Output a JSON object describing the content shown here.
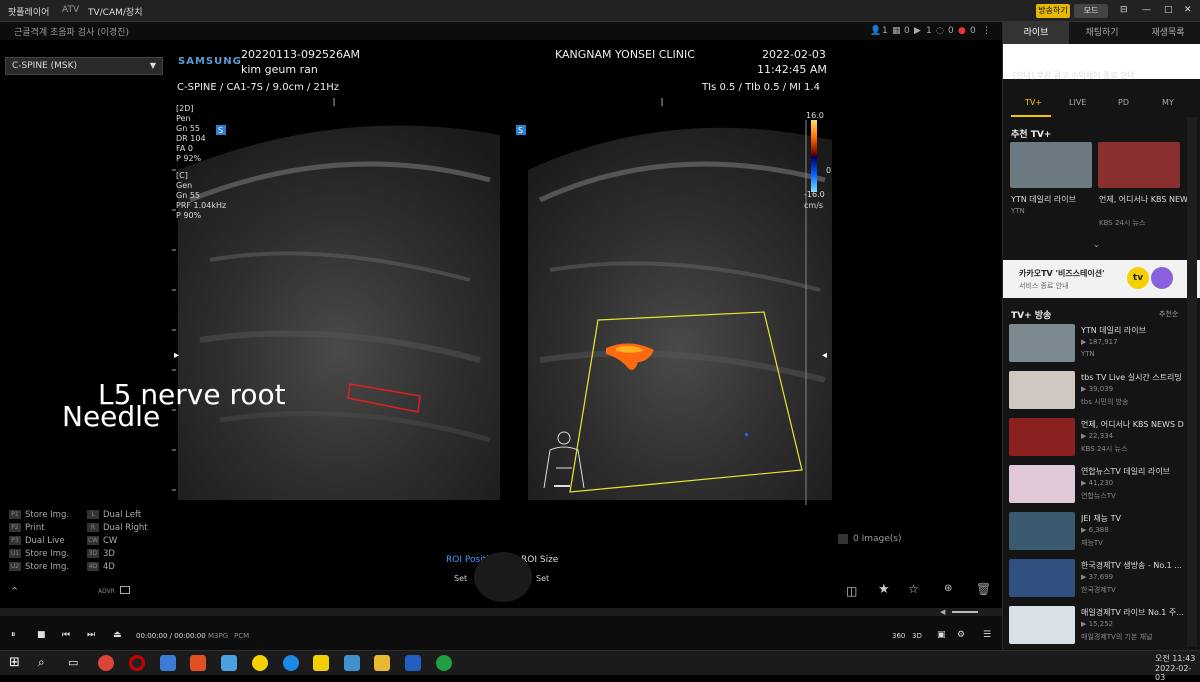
{
  "titlebar": {
    "app": "팟플레이어",
    "atv": "ATV",
    "menu": "TV/CAM/장치",
    "broadcast_btn": "방송하기",
    "mode_btn": "모드"
  },
  "toolbar2": {
    "caption": "근골격계 초음파 검사 (이경진)",
    "stats": [
      "1",
      "0",
      "1",
      "0",
      "0",
      "0"
    ]
  },
  "preset": {
    "value": "C-SPINE (MSK)"
  },
  "ultrasound": {
    "brand": "SAMSUNG",
    "study_id": "20220113-092526AM",
    "patient": "kim geum ran",
    "clinic": "KANGNAM YONSEI CLINIC",
    "date": "2022-02-03",
    "time": "11:42:45 AM",
    "probe": "C-SPINE / CA1-7S / 9.0cm / 21Hz",
    "tis": "TIs  0.5 / TIb  0.5 / MI   1.4",
    "scale_top": "16.0",
    "scale_zero": "0",
    "scale_bottom": "-16.0",
    "scale_unit": "cm/s",
    "params_2d": [
      "[2D]",
      "Pen",
      "Gn    55",
      "DR    104",
      "FA    0",
      "P      92%"
    ],
    "params_c": [
      "[C]",
      "Gen",
      "Gn    55",
      "PRF  1.04kHz",
      "P      90%"
    ],
    "s_marker": "S"
  },
  "overlay": {
    "l5": "L5 nerve root",
    "needle": "Needle"
  },
  "shortcuts": [
    {
      "k": "P1",
      "t": "Store Img."
    },
    {
      "k": "P2",
      "t": "Print"
    },
    {
      "k": "P3",
      "t": "Dual Live"
    },
    {
      "k": "U1",
      "t": "Store Img."
    },
    {
      "k": "U2",
      "t": "Store Img."
    },
    {
      "k": "L",
      "t": "Dual Left"
    },
    {
      "k": "R",
      "t": "Dual Right"
    },
    {
      "k": "CW",
      "t": "CW"
    },
    {
      "k": "3D",
      "t": "3D"
    },
    {
      "k": "4D",
      "t": "4D"
    }
  ],
  "roi": {
    "position": "ROI Position",
    "size": "ROI Size",
    "set_left": "Set",
    "set_right": "Set"
  },
  "images_count": "0 Image(s)",
  "player": {
    "time": "00:00:00 / 00:00:00",
    "codec1": "M3PG",
    "codec2": "PCM",
    "deg": "360",
    "d3": "3D",
    "adv": "ADVR"
  },
  "taskbar": {
    "clock": "오전 11:43",
    "date": "2022-02-03"
  },
  "side": {
    "tabs": [
      "라이브",
      "채팅하기",
      "재생목록"
    ],
    "notice": "[안내] 후원 광고 수익쉐어 종료 안내",
    "subtabs": [
      "TV+",
      "LIVE",
      "PD",
      "MY"
    ],
    "rec_title": "추천 TV+",
    "rec": [
      {
        "t": "YTN 데일리 라이브",
        "s": "YTN"
      },
      {
        "t": "언제, 어디서나 KBS NEWS D",
        "s": "KBS 24시 뉴스"
      }
    ],
    "banner_title": "카카오TV '비즈스테이션'",
    "banner_sub": "서비스 종료 안내",
    "banner_logo": "tv",
    "list_title": "TV+ 방송",
    "sort": "추천순",
    "items": [
      {
        "t": "YTN 데일리 라이브",
        "v": "▶ 187,917",
        "s": "YTN"
      },
      {
        "t": "tbs TV Live 실시간 스트리밍",
        "v": "▶ 39,039",
        "s": "tbs 시민의 방송"
      },
      {
        "t": "언제, 어디서나 KBS NEWS D",
        "v": "▶ 22,334",
        "s": "KBS 24시 뉴스"
      },
      {
        "t": "연합뉴스TV 데일리 라이브",
        "v": "▶ 41,230",
        "s": "연합뉴스TV"
      },
      {
        "t": "JEI 재능 TV",
        "v": "▶ 6,388",
        "s": "재능TV"
      },
      {
        "t": "한국경제TV 생방송 - No.1 ...",
        "v": "▶ 37,699",
        "s": "한국경제TV"
      },
      {
        "t": "매일경제TV 라이브 No.1 주...",
        "v": "▶ 15,252",
        "s": "매일경제TV의 기본 채널"
      }
    ]
  }
}
